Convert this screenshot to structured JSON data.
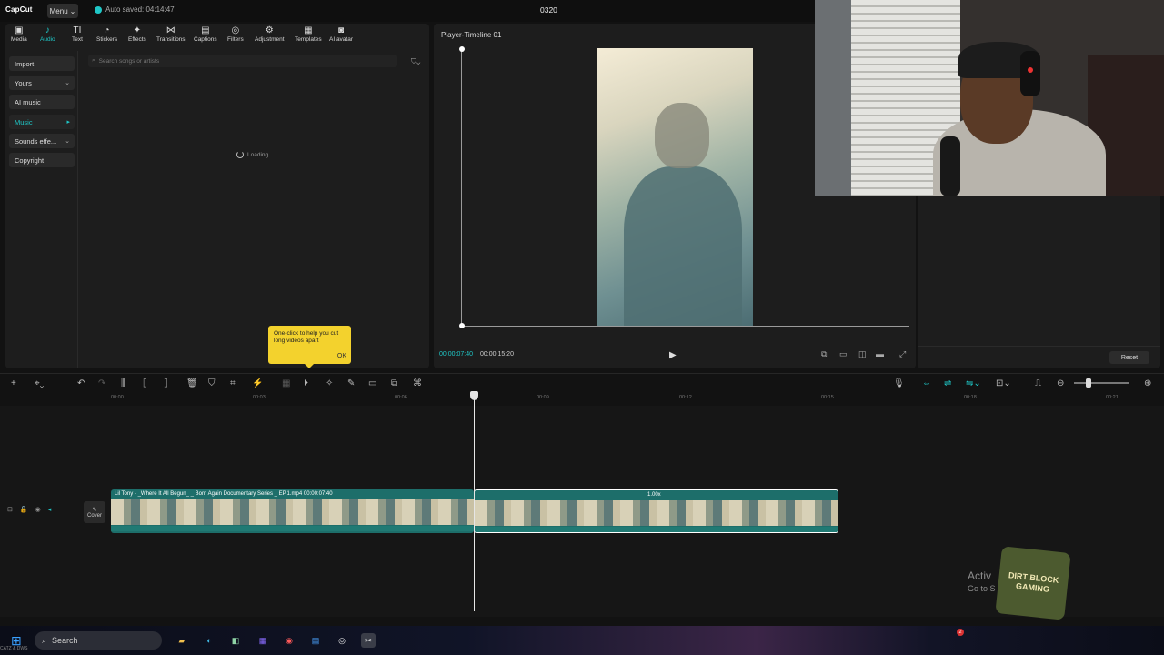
{
  "titlebar": {
    "logo": "CapCut",
    "menu_label": "Menu",
    "autosave": "Auto saved: 04:14:47",
    "project_name": "0320"
  },
  "toolbar_tabs": [
    {
      "icon": "media-icon",
      "glyph": "▣",
      "label": "Media"
    },
    {
      "icon": "audio-icon",
      "glyph": "♪",
      "label": "Audio",
      "active": true
    },
    {
      "icon": "text-icon",
      "glyph": "TI",
      "label": "Text"
    },
    {
      "icon": "stickers-icon",
      "glyph": "◔",
      "label": "Stickers"
    },
    {
      "icon": "effects-icon",
      "glyph": "✦",
      "label": "Effects"
    },
    {
      "icon": "transitions-icon",
      "glyph": "⋈",
      "label": "Transitions"
    },
    {
      "icon": "captions-icon",
      "glyph": "▤",
      "label": "Captions"
    },
    {
      "icon": "filters-icon",
      "glyph": "◎",
      "label": "Filters"
    },
    {
      "icon": "adjustment-icon",
      "glyph": "⚙",
      "label": "Adjustment"
    },
    {
      "icon": "templates-icon",
      "glyph": "▦",
      "label": "Templates"
    },
    {
      "icon": "ai-avatar-icon",
      "glyph": "◙",
      "label": "AI avatar"
    }
  ],
  "sidebar": {
    "items": [
      {
        "label": "Import",
        "chevron": ""
      },
      {
        "label": "Yours",
        "chevron": "⌄"
      },
      {
        "label": "AI music",
        "chevron": ""
      },
      {
        "label": "Music",
        "chevron": "▸"
      },
      {
        "label": "Sounds effe...",
        "chevron": "⌄"
      },
      {
        "label": "Copyright",
        "chevron": ""
      }
    ]
  },
  "search": {
    "placeholder": "Search songs or artists"
  },
  "loading_text": "Loading...",
  "tooltip": {
    "text": "One-click to help you cut long videos apart",
    "ok": "OK"
  },
  "player": {
    "title": "Player-Timeline 01",
    "current_time": "00:00:07:40",
    "total_time": "00:00:15:20"
  },
  "right_panel": {
    "reset_label": "Reset"
  },
  "ruler": {
    "labels": [
      "00:00",
      "00:03",
      "00:06",
      "00:09",
      "00:12",
      "00:15",
      "00:18",
      "00:21"
    ]
  },
  "timeline": {
    "cover_label": "Cover",
    "clip_a_label": "Lil Tony - _Where It All Begun_ _ Born Again Documentary Series _ EP.1.mp4   00:00:07:40",
    "clip_b_speed": "1.00x"
  },
  "watermark": {
    "line1": "Activ",
    "line2": "Go to S                    Windows.",
    "badge_line1": "DIRT BLOCK",
    "badge_line2": "GAMING"
  },
  "taskbar": {
    "search_label": "Search",
    "notification_count": "2",
    "corner_text": "CATZ & DWS"
  },
  "colors": {
    "accent": "#1fc7c7",
    "tooltip": "#f3d22d",
    "clip": "#1d6e6a"
  }
}
